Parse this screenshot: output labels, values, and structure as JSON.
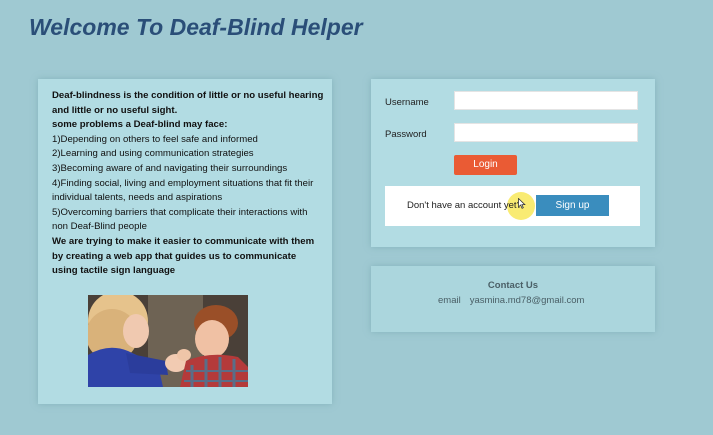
{
  "title": "Welcome To Deaf-Blind Helper",
  "info": {
    "intro": "Deaf-blindness is the condition of little or no useful hearing and little or no useful sight.",
    "problems_heading": "some problems a Deaf-blind may face:",
    "problems": [
      "1)Depending on others to feel safe and informed",
      "2)Learning and using communication strategies",
      "3)Becoming aware of and navigating their surroundings",
      "4)Finding social, living and employment situations that fit their individual talents, needs and aspirations",
      "5)Overcoming barriers that complicate their interactions with non Deaf-Blind people"
    ],
    "mission": "We are trying to make it easier to communicate with them by creating a web app that guides us to communicate using tactile sign language"
  },
  "login": {
    "username_label": "Username",
    "username_value": "",
    "password_label": "Password",
    "password_value": "",
    "login_button": "Login",
    "signup_prompt": "Don't have an account yet?",
    "signup_button": "Sign up"
  },
  "contact": {
    "title": "Contact Us",
    "email_label": "email",
    "email_value": "yasmina.md78@gmail.com"
  },
  "colors": {
    "background": "#9fc9d2",
    "panel": "#b2dce3",
    "title": "#2a4e78",
    "login_button": "#ea5b34",
    "signup_button": "#3a8dbe"
  },
  "icons": [
    "cursor-arrow-icon"
  ]
}
